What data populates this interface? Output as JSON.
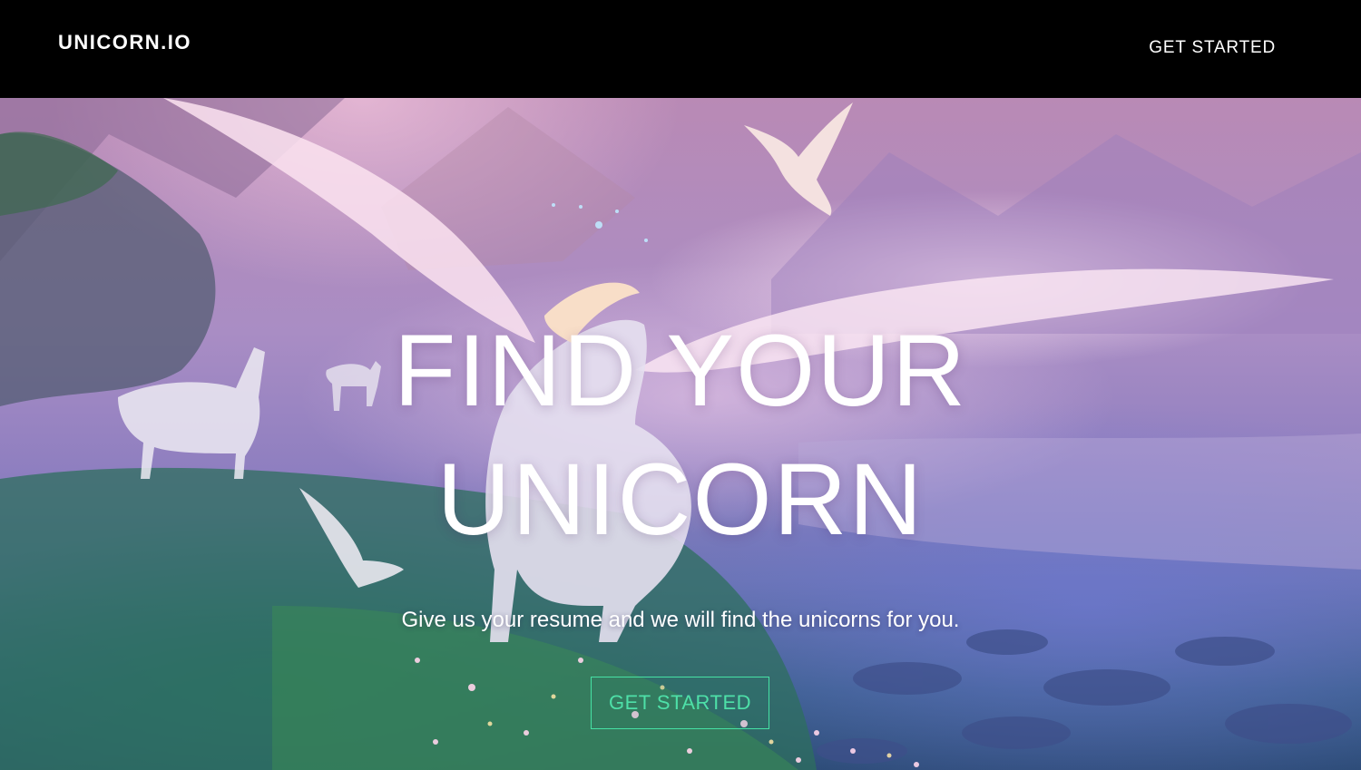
{
  "navbar": {
    "brand": "UNICORN.IO",
    "cta_label": "GET STARTED"
  },
  "hero": {
    "headline_line1": "FIND YOUR",
    "headline_line2": "UNICORN",
    "subtitle": "Give us your resume and we will find the unicorns for you.",
    "cta_label": "GET STARTED"
  },
  "colors": {
    "navbar_bg": "#000000",
    "text": "#ffffff",
    "cta_accent": "#46e2a5"
  }
}
